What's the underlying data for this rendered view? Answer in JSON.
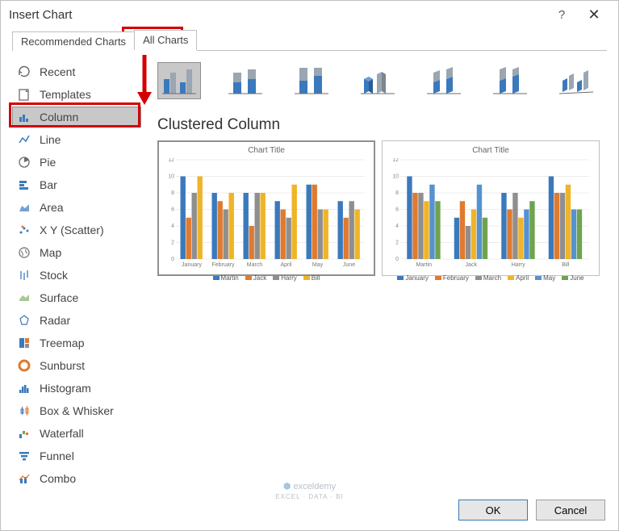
{
  "window": {
    "title": "Insert Chart",
    "help": "?",
    "close": "✕"
  },
  "tabs": {
    "recommended": "Recommended Charts",
    "all": "All Charts"
  },
  "sidebar": {
    "items": [
      {
        "label": "Recent",
        "icon": "recent-icon"
      },
      {
        "label": "Templates",
        "icon": "templates-icon"
      },
      {
        "label": "Column",
        "icon": "column-icon",
        "selected": true
      },
      {
        "label": "Line",
        "icon": "line-icon"
      },
      {
        "label": "Pie",
        "icon": "pie-icon"
      },
      {
        "label": "Bar",
        "icon": "bar-icon"
      },
      {
        "label": "Area",
        "icon": "area-icon"
      },
      {
        "label": "X Y (Scatter)",
        "icon": "scatter-icon"
      },
      {
        "label": "Map",
        "icon": "map-icon"
      },
      {
        "label": "Stock",
        "icon": "stock-icon"
      },
      {
        "label": "Surface",
        "icon": "surface-icon"
      },
      {
        "label": "Radar",
        "icon": "radar-icon"
      },
      {
        "label": "Treemap",
        "icon": "treemap-icon"
      },
      {
        "label": "Sunburst",
        "icon": "sunburst-icon"
      },
      {
        "label": "Histogram",
        "icon": "histogram-icon"
      },
      {
        "label": "Box & Whisker",
        "icon": "boxwhisker-icon"
      },
      {
        "label": "Waterfall",
        "icon": "waterfall-icon"
      },
      {
        "label": "Funnel",
        "icon": "funnel-icon"
      },
      {
        "label": "Combo",
        "icon": "combo-icon"
      }
    ]
  },
  "subtypes": [
    "clustered-column",
    "stacked-column",
    "stacked100-column",
    "3d-clustered-column",
    "3d-stacked-column",
    "3d-stacked100-column",
    "3d-column"
  ],
  "subtitle": "Clustered Column",
  "preview": {
    "chart_title": "Chart Title",
    "yticks": [
      0,
      2,
      4,
      6,
      8,
      10,
      12
    ],
    "left": {
      "categories": [
        "January",
        "February",
        "March",
        "April",
        "May",
        "June"
      ],
      "series": [
        "Martin",
        "Jack",
        "Harry",
        "Bill"
      ]
    },
    "right": {
      "categories": [
        "Martin",
        "Jack",
        "Harry",
        "Bill"
      ],
      "series": [
        "January",
        "February",
        "March",
        "April",
        "May",
        "June"
      ]
    }
  },
  "chart_data": [
    {
      "type": "bar",
      "title": "Chart Title",
      "ylim": [
        0,
        12
      ],
      "categories": [
        "January",
        "February",
        "March",
        "April",
        "May",
        "June"
      ],
      "series": [
        {
          "name": "Martin",
          "color": "#3b79bd",
          "values": [
            10,
            8,
            8,
            7,
            9,
            7
          ]
        },
        {
          "name": "Jack",
          "color": "#e07a2e",
          "values": [
            5,
            7,
            4,
            6,
            9,
            5
          ]
        },
        {
          "name": "Harry",
          "color": "#8f8f8f",
          "values": [
            8,
            6,
            8,
            5,
            6,
            7
          ]
        },
        {
          "name": "Bill",
          "color": "#f0b429",
          "values": [
            10,
            8,
            8,
            9,
            6,
            6
          ]
        }
      ]
    },
    {
      "type": "bar",
      "title": "Chart Title",
      "ylim": [
        0,
        12
      ],
      "categories": [
        "Martin",
        "Jack",
        "Harry",
        "Bill"
      ],
      "series": [
        {
          "name": "January",
          "color": "#3b79bd",
          "values": [
            10,
            5,
            8,
            10
          ]
        },
        {
          "name": "February",
          "color": "#e07a2e",
          "values": [
            8,
            7,
            6,
            8
          ]
        },
        {
          "name": "March",
          "color": "#8f8f8f",
          "values": [
            8,
            4,
            8,
            8
          ]
        },
        {
          "name": "April",
          "color": "#f0b429",
          "values": [
            7,
            6,
            5,
            9
          ]
        },
        {
          "name": "May",
          "color": "#5592cf",
          "values": [
            9,
            9,
            6,
            6
          ]
        },
        {
          "name": "June",
          "color": "#6fa34e",
          "values": [
            7,
            5,
            7,
            6
          ]
        }
      ]
    }
  ],
  "buttons": {
    "ok": "OK",
    "cancel": "Cancel"
  },
  "watermark": {
    "brand": "exceldemy",
    "tagline": "EXCEL · DATA · BI"
  }
}
